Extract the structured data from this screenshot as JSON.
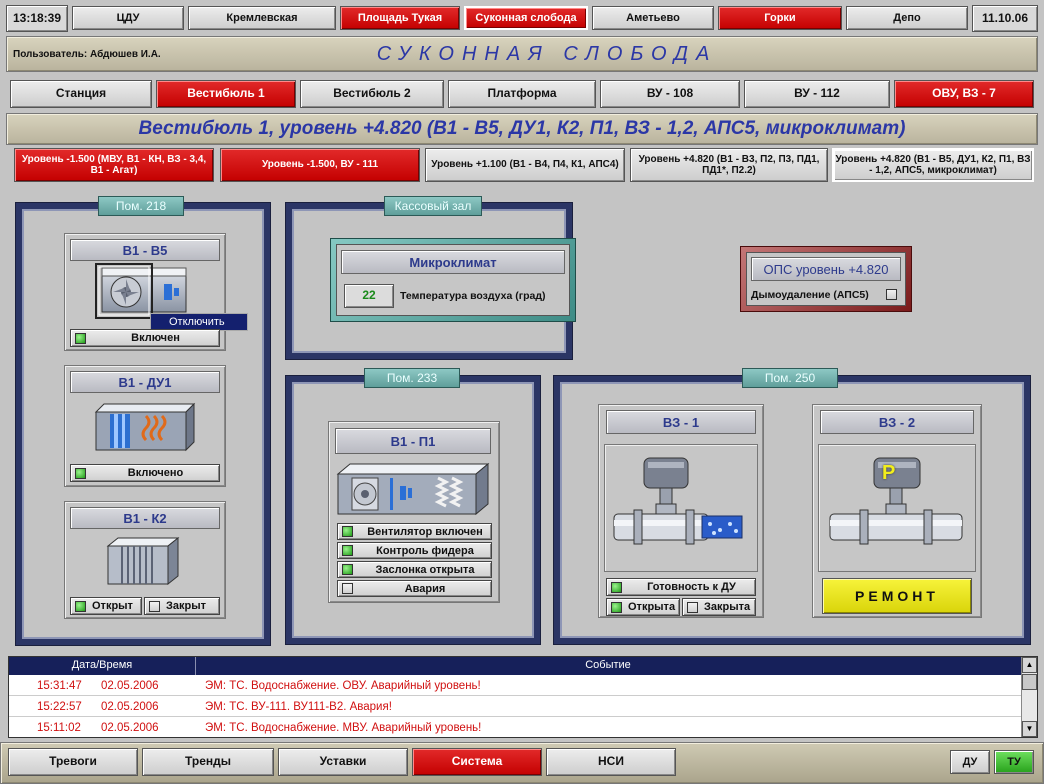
{
  "header": {
    "time": "13:18:39",
    "date": "11.10.06",
    "stations": [
      "ЦДУ",
      "Кремлевская",
      "Площадь Тукая",
      "Суконная слобода",
      "Аметьево",
      "Горки",
      "Депо"
    ],
    "user_label": "Пользователь: Абдюшев И.А.",
    "station_title": "СУКОННАЯ СЛОБОДА"
  },
  "tabs": [
    "Станция",
    "Вестибюль 1",
    "Вестибюль 2",
    "Платформа",
    "ВУ - 108",
    "ВУ - 112",
    "ОВУ, ВЗ - 7"
  ],
  "page_title": "Вестибюль 1, уровень +4.820 (В1 - В5, ДУ1, К2, П1, ВЗ - 1,2, АПС5, микроклимат)",
  "levels": [
    "Уровень -1.500 (МВУ, В1 - КН, ВЗ - 3,4, В1 - Агат)",
    "Уровень -1.500, ВУ - 111",
    "Уровень +1.100 (В1 - В4, П4, К1, АПС4)",
    "Уровень +4.820 (В1 - В3, П2, П3, ПД1, ПД1*, П2.2)",
    "Уровень +4.820 (В1 - В5, ДУ1, К2, П1, ВЗ - 1,2, АПС5, микроклимат)"
  ],
  "room218": {
    "title": "Пом. 218",
    "v1b5": {
      "title": "В1 - В5",
      "status": "Включен"
    },
    "context_menu": "Отключить",
    "v1du1": {
      "title": "В1 - ДУ1",
      "status": "Включено"
    },
    "v1k2": {
      "title": "В1 - К2",
      "open": "Открыт",
      "closed": "Закрыт"
    }
  },
  "kassa": {
    "title": "Кассовый зал",
    "micro_title": "Микроклимат",
    "temp_value": "22",
    "temp_label": "Температура воздуха (град)"
  },
  "ops": {
    "title": "ОПС уровень +4.820",
    "smoke": "Дымоудаление (АПС5)"
  },
  "room233": {
    "title": "Пом. 233",
    "unit": "В1 - П1",
    "statuses": [
      "Вентилятор включен",
      "Контроль фидера",
      "Заслонка открыта",
      "Авария"
    ]
  },
  "room250": {
    "title": "Пом. 250",
    "vz1": {
      "title": "ВЗ - 1",
      "ready": "Готовность к ДУ",
      "open": "Открыта",
      "closed": "Закрыта"
    },
    "vz2": {
      "title": "ВЗ - 2",
      "repair": "РЕМОНТ",
      "badge": "P"
    }
  },
  "events": {
    "headers": [
      "Дата/Время",
      "Событие"
    ],
    "rows": [
      {
        "time": "15:31:47",
        "date": "02.05.2006",
        "text": "ЭМ: ТС. Водоснабжение. ОВУ.  Аварийный уровень!"
      },
      {
        "time": "15:22:57",
        "date": "02.05.2006",
        "text": "ЭМ: ТС. ВУ-111. ВУ111-В2.  Авария!"
      },
      {
        "time": "15:11:02",
        "date": "02.05.2006",
        "text": "ЭМ: ТС. Водоснабжение. МВУ.  Аварийный уровень!"
      }
    ]
  },
  "footer": {
    "buttons": [
      "Тревоги",
      "Тренды",
      "Уставки",
      "Система",
      "НСИ"
    ],
    "du": "ДУ",
    "tu": "ТУ"
  },
  "colors": {
    "accent_red": "#c40000",
    "frame_navy": "#2b3565",
    "title_blue": "#2b37a6",
    "led_green": "#1f9a17",
    "repair_yellow": "#f2ee1c"
  }
}
